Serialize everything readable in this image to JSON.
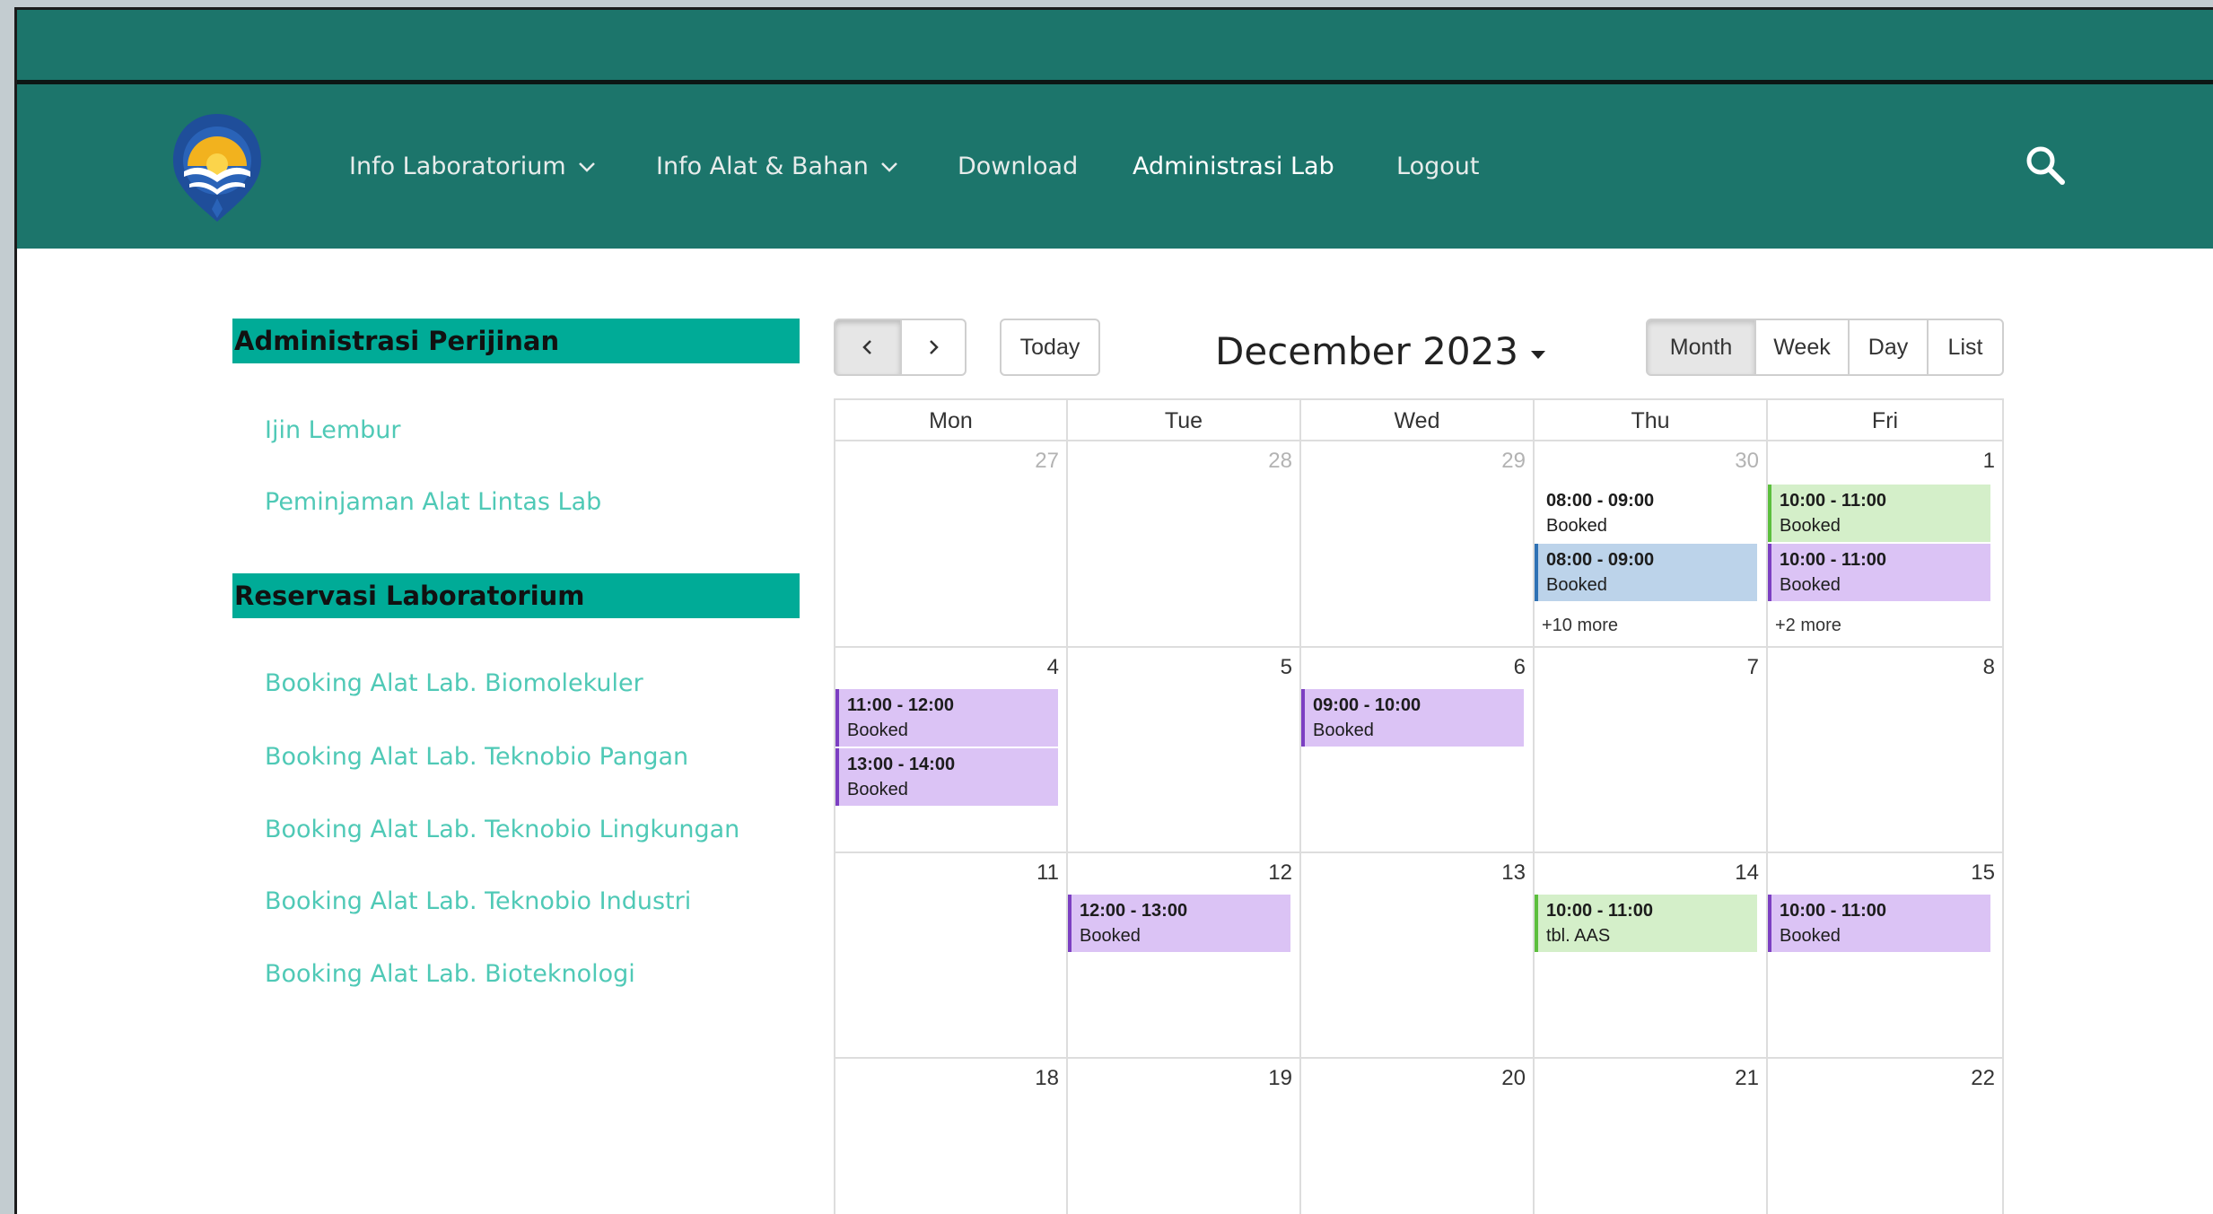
{
  "nav": {
    "items": [
      {
        "label": "Info Laboratorium",
        "dropdown": true
      },
      {
        "label": "Info Alat & Bahan",
        "dropdown": true
      },
      {
        "label": "Download",
        "dropdown": false
      },
      {
        "label": "Administrasi Lab",
        "dropdown": false,
        "active": true
      },
      {
        "label": "Logout",
        "dropdown": false
      }
    ]
  },
  "sidebar": {
    "sections": [
      {
        "heading": "Administrasi Perijinan",
        "links": [
          "Ijin Lembur",
          "Peminjaman Alat Lintas Lab"
        ]
      },
      {
        "heading": "Reservasi Laboratorium",
        "links": [
          "Booking Alat Lab. Biomolekuler",
          "Booking Alat Lab. Teknobio Pangan",
          "Booking Alat Lab. Teknobio Lingkungan",
          "Booking Alat Lab. Teknobio Industri",
          "Booking Alat Lab. Bioteknologi"
        ]
      }
    ]
  },
  "calendar": {
    "today_label": "Today",
    "title": "December 2023",
    "views": [
      "Month",
      "Week",
      "Day",
      "List"
    ],
    "active_view": "Month",
    "weekdays": [
      "Mon",
      "Tue",
      "Wed",
      "Thu",
      "Fri"
    ],
    "weeks": [
      [
        {
          "day": "27",
          "other": true,
          "events": []
        },
        {
          "day": "28",
          "other": true,
          "events": []
        },
        {
          "day": "29",
          "other": true,
          "events": []
        },
        {
          "day": "30",
          "other": true,
          "events": [
            {
              "time": "08:00 - 09:00",
              "title": "Booked",
              "color": "white"
            },
            {
              "time": "08:00 - 09:00",
              "title": "Booked",
              "color": "blue"
            }
          ],
          "more": "+10 more"
        },
        {
          "day": "1",
          "other": false,
          "events": [
            {
              "time": "10:00 - 11:00",
              "title": "Booked",
              "color": "green"
            },
            {
              "time": "10:00 - 11:00",
              "title": "Booked",
              "color": "purple"
            }
          ],
          "more": "+2 more"
        }
      ],
      [
        {
          "day": "4",
          "other": false,
          "events": [
            {
              "time": "11:00 - 12:00",
              "title": "Booked",
              "color": "purple"
            },
            {
              "time": "13:00 - 14:00",
              "title": "Booked",
              "color": "purple"
            }
          ]
        },
        {
          "day": "5",
          "other": false,
          "events": []
        },
        {
          "day": "6",
          "other": false,
          "events": [
            {
              "time": "09:00 - 10:00",
              "title": "Booked",
              "color": "purple"
            }
          ]
        },
        {
          "day": "7",
          "other": false,
          "events": []
        },
        {
          "day": "8",
          "other": false,
          "events": []
        }
      ],
      [
        {
          "day": "11",
          "other": false,
          "events": []
        },
        {
          "day": "12",
          "other": false,
          "events": [
            {
              "time": "12:00 - 13:00",
              "title": "Booked",
              "color": "purple"
            }
          ]
        },
        {
          "day": "13",
          "other": false,
          "events": []
        },
        {
          "day": "14",
          "other": false,
          "events": [
            {
              "time": "10:00 - 11:00",
              "title": "tbl. AAS",
              "color": "green"
            }
          ]
        },
        {
          "day": "15",
          "other": false,
          "events": [
            {
              "time": "10:00 - 11:00",
              "title": "Booked",
              "color": "purple"
            }
          ]
        }
      ],
      [
        {
          "day": "18",
          "other": false,
          "events": []
        },
        {
          "day": "19",
          "other": false,
          "events": []
        },
        {
          "day": "20",
          "other": false,
          "events": []
        },
        {
          "day": "21",
          "other": false,
          "events": []
        },
        {
          "day": "22",
          "other": false,
          "events": []
        }
      ]
    ]
  },
  "icons": {
    "logo": "university-logo",
    "search": "search-icon",
    "prev": "chevron-left-icon",
    "next": "chevron-right-icon",
    "dropdown": "chevron-down-icon"
  },
  "colors": {
    "header": "#1c756b",
    "sidebar_heading": "#00ab97",
    "sidebar_link": "#4fc9b6",
    "event_blue": "#bcd3ea",
    "event_green": "#d4efc9",
    "event_purple": "#dbc3f5"
  }
}
